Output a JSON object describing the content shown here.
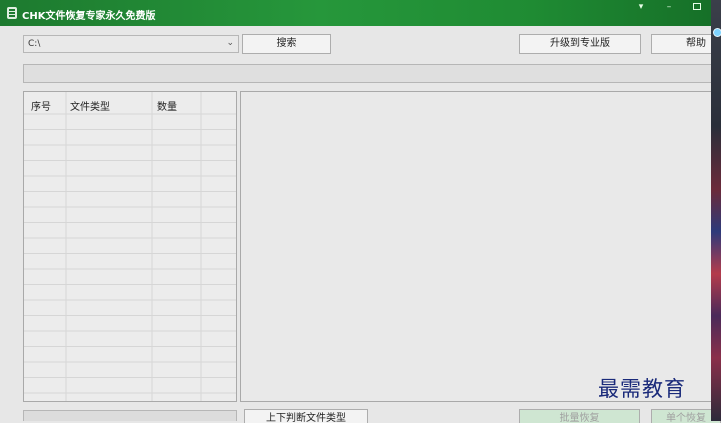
{
  "window": {
    "title": "CHK文件恢复专家永久免费版",
    "controls": {
      "menu_glyph": "▾",
      "minimize_glyph": "–"
    }
  },
  "toolbar": {
    "drive": {
      "value": "C:\\",
      "chevron": "⌄"
    },
    "search_label": "搜索",
    "upgrade_label": "升级到专业版",
    "help_label": "帮助"
  },
  "progress": {
    "value_percent": 0,
    "fill_color": "#06b025"
  },
  "file_types_table": {
    "columns": [
      "序号",
      "文件类型",
      "数量"
    ],
    "rows": []
  },
  "bottom": {
    "stop_label": "上下判断文件类型",
    "batch_restore_label": "批量恢复",
    "single_restore_label": "单个恢复"
  },
  "watermark": "最需教育",
  "colors": {
    "titlebar": "#1f8b33",
    "accent": "#06b025"
  }
}
